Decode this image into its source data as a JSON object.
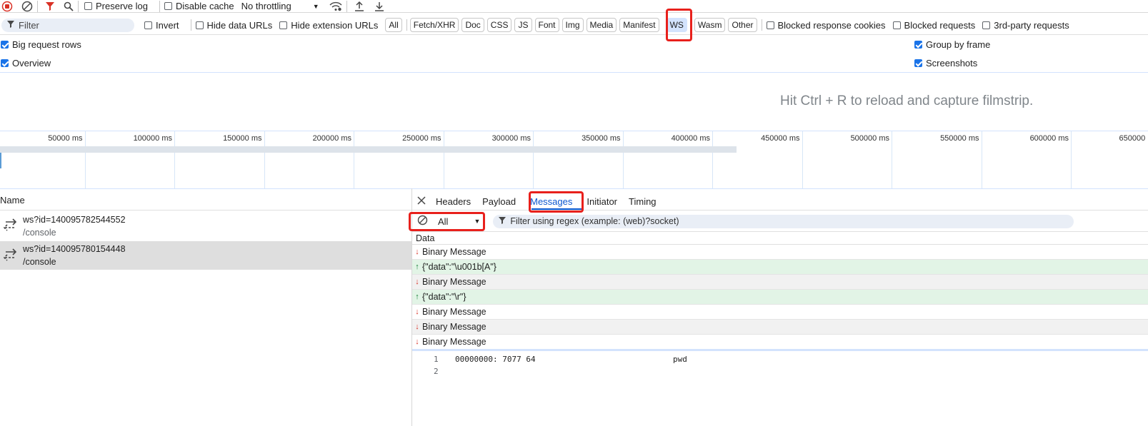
{
  "toolbar": {
    "preserve_log": "Preserve log",
    "disable_cache": "Disable cache",
    "throttling": "No throttling"
  },
  "filterbar": {
    "filter_placeholder": "Filter",
    "invert": "Invert",
    "hide_data_urls": "Hide data URLs",
    "hide_extension_urls": "Hide extension URLs",
    "types": [
      "All",
      "Fetch/XHR",
      "Doc",
      "CSS",
      "JS",
      "Font",
      "Img",
      "Media",
      "Manifest",
      "WS",
      "Wasm",
      "Other"
    ],
    "active_type": "WS",
    "blocked_response_cookies": "Blocked response cookies",
    "blocked_requests": "Blocked requests",
    "third_party_requests": "3rd-party requests"
  },
  "settings": {
    "big_request_rows": "Big request rows",
    "overview": "Overview",
    "group_by_frame": "Group by frame",
    "screenshots": "Screenshots"
  },
  "filmstrip": {
    "hint": "Hit Ctrl + R to reload and capture filmstrip."
  },
  "timeline": {
    "ticks": [
      "50000 ms",
      "100000 ms",
      "150000 ms",
      "200000 ms",
      "250000 ms",
      "300000 ms",
      "350000 ms",
      "400000 ms",
      "450000 ms",
      "500000 ms",
      "550000 ms",
      "600000 ms",
      "650000"
    ]
  },
  "requests": {
    "column_name": "Name",
    "items": [
      {
        "name": "ws?id=140095782544552",
        "path": "/console"
      },
      {
        "name": "ws?id=140095780154448",
        "path": "/console"
      }
    ]
  },
  "detail": {
    "tabs": [
      "Headers",
      "Payload",
      "Messages",
      "Initiator",
      "Timing"
    ],
    "active_tab": "Messages",
    "message_filter_select": "All",
    "regex_filter_placeholder": "Filter using regex (example: (web)?socket)",
    "data_column": "Data",
    "messages": [
      {
        "dir": "down",
        "text": "Binary Message"
      },
      {
        "dir": "up",
        "text": "{\"data\":\"\\u001b[A\"}"
      },
      {
        "dir": "down",
        "text": "Binary Message"
      },
      {
        "dir": "up",
        "text": "{\"data\":\"\\r\"}"
      },
      {
        "dir": "down",
        "text": "Binary Message"
      },
      {
        "dir": "down",
        "text": "Binary Message"
      },
      {
        "dir": "down",
        "text": "Binary Message"
      }
    ],
    "hex_lines": [
      {
        "num": "1",
        "offset": "00000000: 7077 64",
        "ascii": "pwd"
      },
      {
        "num": "2",
        "offset": "",
        "ascii": ""
      }
    ]
  },
  "colors": {
    "accent": "#0b57d0",
    "highlight_red": "#e8201c",
    "sent_bg": "#e2f4e6",
    "selected_row": "#dedede"
  }
}
